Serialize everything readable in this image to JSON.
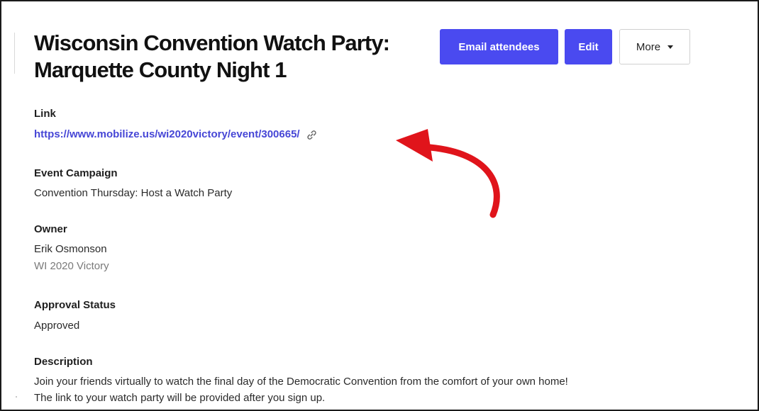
{
  "event": {
    "title_line1": "Wisconsin Convention Watch Party:",
    "title_line2": "Marquette County Night 1"
  },
  "actions": {
    "email_label": "Email attendees",
    "edit_label": "Edit",
    "more_label": "More"
  },
  "link": {
    "label": "Link",
    "url": "https://www.mobilize.us/wi2020victory/event/300665/"
  },
  "campaign": {
    "label": "Event Campaign",
    "value": "Convention Thursday: Host a Watch Party"
  },
  "owner": {
    "label": "Owner",
    "name": "Erik Osmonson",
    "organization": "WI 2020 Victory"
  },
  "approval": {
    "label": "Approval Status",
    "value": "Approved"
  },
  "description": {
    "label": "Description",
    "line1": "Join your friends virtually to watch the final day of the Democratic Convention from the comfort of your own home!",
    "line2": "The link to your watch party will be provided after you sign up."
  },
  "colors": {
    "primary_button": "#4a4af0",
    "link": "#4646d6",
    "annotation_arrow": "#e0141b"
  },
  "icons": {
    "copy_link": "link-icon",
    "dropdown": "chevron-down-icon",
    "annotation": "curved-arrow-icon"
  }
}
